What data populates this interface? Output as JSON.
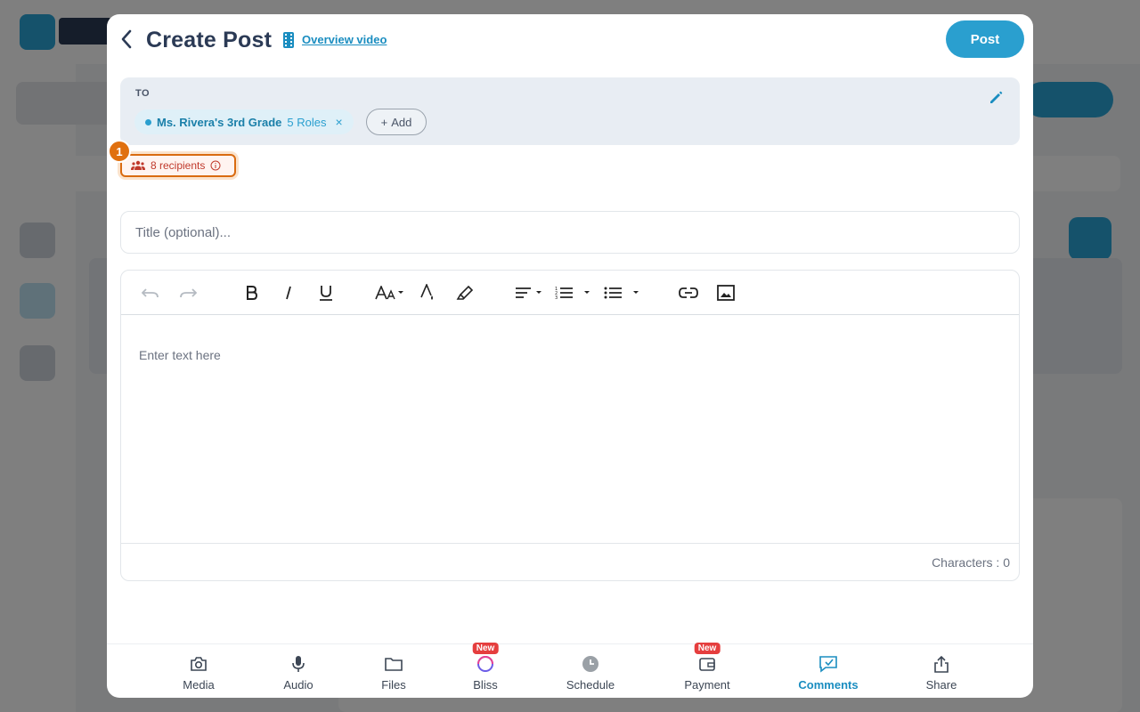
{
  "header": {
    "title": "Create Post",
    "overview_link": "Overview video",
    "post_button": "Post"
  },
  "to": {
    "label": "TO",
    "chip": {
      "name": "Ms. Rivera's 3rd Grade",
      "roles": "5 Roles",
      "remove": "×"
    },
    "add_button": "Add"
  },
  "recipients": {
    "step_number": "1",
    "label": "8 recipients"
  },
  "title_input": {
    "placeholder": "Title (optional)...",
    "value": ""
  },
  "editor": {
    "placeholder": "Enter text here",
    "char_count": "Characters : 0",
    "toolbar": [
      "undo-icon",
      "redo-icon",
      "bold-icon",
      "italic-icon",
      "underline-icon",
      "font-size-icon",
      "text-color-icon",
      "highlight-icon",
      "align-icon",
      "numbered-list-icon",
      "bullet-list-icon",
      "link-icon",
      "image-icon"
    ]
  },
  "bottom_bar": {
    "items": [
      {
        "label": "Media",
        "icon": "camera-icon"
      },
      {
        "label": "Audio",
        "icon": "microphone-icon"
      },
      {
        "label": "Files",
        "icon": "folder-icon"
      },
      {
        "label": "Bliss",
        "icon": "bliss-icon",
        "badge": "New"
      },
      {
        "label": "Schedule",
        "icon": "clock-icon"
      },
      {
        "label": "Payment",
        "icon": "payment-icon",
        "badge": "New"
      },
      {
        "label": "Comments",
        "icon": "comments-icon",
        "active": true
      },
      {
        "label": "Share",
        "icon": "share-icon"
      }
    ]
  },
  "colors": {
    "accent": "#2a9fcf",
    "title": "#2b3a55",
    "highlight": "#e0700f",
    "badge_red": "#e53e3e"
  }
}
